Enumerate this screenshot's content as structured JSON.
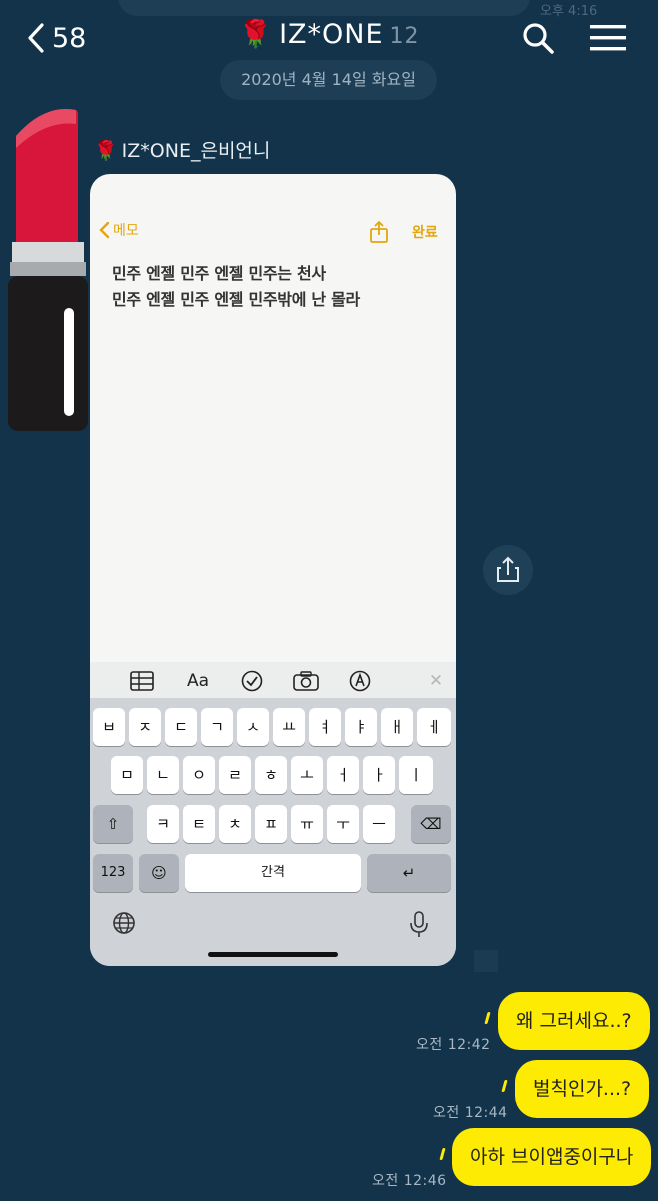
{
  "header": {
    "back_count": "58",
    "room_title": "IZ*ONE",
    "member_count": "12",
    "date_divider": "2020년 4월 14일 화요일"
  },
  "faded_time": "오후 4:16",
  "sender": {
    "name": "IZ*ONE_은비언니"
  },
  "photo": {
    "memo_back": "메모",
    "done": "완료",
    "note_lines": [
      "민주 엔젤 민주 엔젤 민주는 천사",
      "민주 엔젤 민주 엔젤 민주밖에 난 몰라"
    ],
    "toolbar_format": "Aa",
    "keyboard": {
      "row1": [
        "ㅂ",
        "ㅈ",
        "ㄷ",
        "ㄱ",
        "ㅅ",
        "ㅛ",
        "ㅕ",
        "ㅑ",
        "ㅐ",
        "ㅔ"
      ],
      "row2": [
        "ㅁ",
        "ㄴ",
        "ㅇ",
        "ㄹ",
        "ㅎ",
        "ㅗ",
        "ㅓ",
        "ㅏ",
        "ㅣ"
      ],
      "row3": [
        "ㅋ",
        "ㅌ",
        "ㅊ",
        "ㅍ",
        "ㅠ",
        "ㅜ",
        "ㅡ"
      ],
      "numbers": "123",
      "space": "간격"
    }
  },
  "messages": [
    {
      "text": "왜 그러세요..?",
      "time": "오전 12:42"
    },
    {
      "text": "벌칙인가...?",
      "time": "오전 12:44"
    },
    {
      "text": "아하 브이앱중이구나",
      "time": "오전 12:46"
    }
  ],
  "colors": {
    "background": "#12334a",
    "bubble": "#fdeb03",
    "rose": "#d01735",
    "accent_memo": "#e3a60d"
  },
  "icons": [
    "back-chevron-icon",
    "rose-icon",
    "search-icon",
    "hamburger-menu-icon",
    "share-icon",
    "grid-table-icon",
    "checkmark-circle-icon",
    "camera-icon",
    "pen-markup-icon",
    "close-icon",
    "shift-icon",
    "emoji-icon",
    "return-icon",
    "delete-icon",
    "globe-icon",
    "microphone-icon"
  ]
}
